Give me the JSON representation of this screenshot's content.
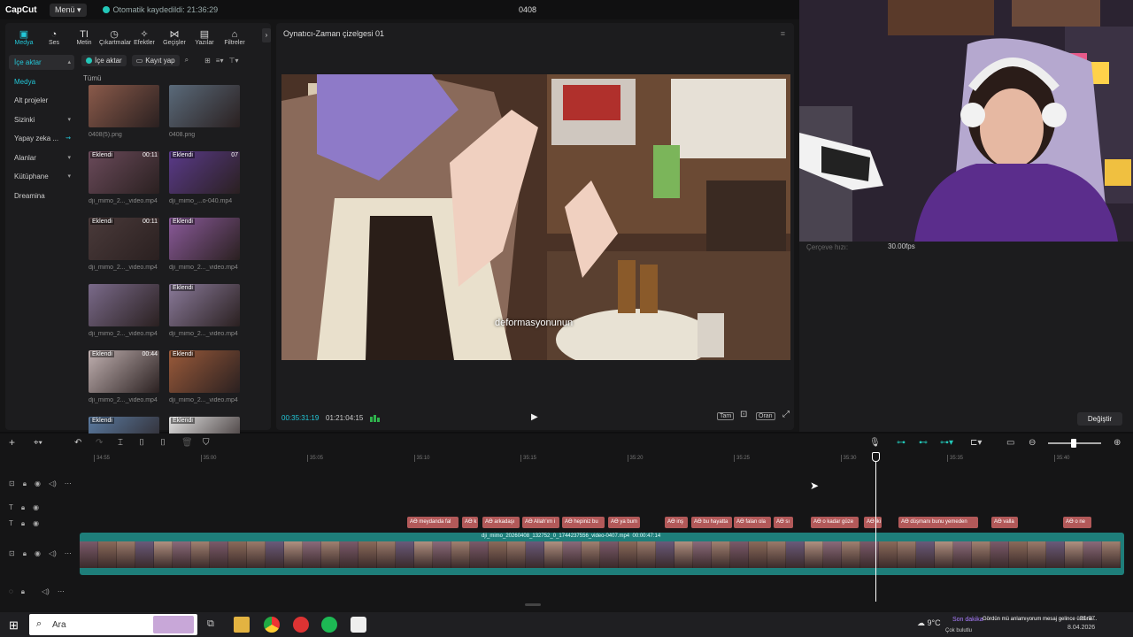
{
  "titlebar": {
    "logo": "CapCut",
    "menu_label": "Menü",
    "save_status": "Otomatik kaydedildi: 21:36:29",
    "project_name": "0408"
  },
  "toolbar": {
    "items": [
      {
        "label": "Medya",
        "icon": "media-icon"
      },
      {
        "label": "Ses",
        "icon": "audio-icon"
      },
      {
        "label": "Metin",
        "icon": "text-icon"
      },
      {
        "label": "Çıkartmalar",
        "icon": "sticker-icon"
      },
      {
        "label": "Efektler",
        "icon": "effects-icon"
      },
      {
        "label": "Geçişler",
        "icon": "transitions-icon"
      },
      {
        "label": "Yazılar",
        "icon": "captions-icon"
      },
      {
        "label": "Filtreler",
        "icon": "filters-icon"
      }
    ]
  },
  "sidenav": {
    "items": [
      "İçe aktar",
      "Medya",
      "Alt projeler",
      "Sizinki",
      "Yapay zeka ...",
      "Alanlar",
      "Kütüphane",
      "Dreamina"
    ]
  },
  "media": {
    "import_label": "İçe aktar",
    "record_label": "Kayıt yap",
    "all_label": "Tümü",
    "items": [
      {
        "name": "0408(5).png",
        "badge": "",
        "duration": ""
      },
      {
        "name": "0408.png",
        "badge": "",
        "duration": ""
      },
      {
        "name": "dji_mimo_2..._video.mp4",
        "badge": "Eklendi",
        "duration": "00:11"
      },
      {
        "name": "dji_mimo_...o-040.mp4",
        "badge": "Eklendi",
        "duration": "07"
      },
      {
        "name": "dji_mimo_2..._video.mp4",
        "badge": "Eklendi",
        "duration": "00:11"
      },
      {
        "name": "dji_mimo_2..._video.mp4",
        "badge": "Eklendi",
        "duration": ""
      },
      {
        "name": "dji_mimo_2..._video.mp4",
        "badge": "",
        "duration": ""
      },
      {
        "name": "dji_mimo_2..._video.mp4",
        "badge": "Eklendi",
        "duration": ""
      },
      {
        "name": "dji_mimo_2..._video.mp4",
        "badge": "Eklendi",
        "duration": "00:44"
      },
      {
        "name": "dji_mimo_2..._video.mp4",
        "badge": "Eklendi",
        "duration": ""
      },
      {
        "name": "",
        "badge": "Eklendi",
        "duration": ""
      },
      {
        "name": "",
        "badge": "Eklendi",
        "duration": ""
      }
    ]
  },
  "player": {
    "title": "Oynatıcı-Zaman çizelgesi 01",
    "caption": "deformasyonunun",
    "current_time": "00:35:31:19",
    "total_time": "01:21:04:15",
    "full_label": "Tam",
    "ratio_label": "Oran"
  },
  "properties": {
    "frame_rate_label": "Çerçeve hızı:",
    "frame_rate_value": "30.00fps",
    "change_label": "Değiştir"
  },
  "timeline": {
    "ticks": [
      "34:55",
      "35:00",
      "35:05",
      "35:10",
      "35:15",
      "35:20",
      "35:25",
      "35:30",
      "35:35",
      "35:40"
    ],
    "subtitle_clips": [
      {
        "text": "AƟ meydanda fal"
      },
      {
        "text": "AƟ k"
      },
      {
        "text": "AƟ arkadaşı"
      },
      {
        "text": "AƟ Allah'ım i"
      },
      {
        "text": "AƟ hepiniz bu"
      },
      {
        "text": "AƟ ya bum"
      },
      {
        "text": "AƟ inş"
      },
      {
        "text": "AƟ bu hayatta"
      },
      {
        "text": "AƟ falan ola"
      },
      {
        "text": "AƟ sı"
      },
      {
        "text": "AƟ o kadar güze"
      },
      {
        "text": "AƟ iki"
      },
      {
        "text": "AƟ düşmanı bunu yemeden"
      },
      {
        "text": "AƟ valla"
      },
      {
        "text": "AƟ o ne"
      }
    ],
    "video_clip_label": "dji_mimo_20260408_132752_0_1744237556_video-0407.mp4",
    "video_clip_duration": "00:00:47:14"
  },
  "taskbar": {
    "search_placeholder": "Ara",
    "weather": "9°C",
    "weather_sub": "Çok bulutlu",
    "news_label": "Son dakika",
    "message": "Gördün mü anlamıyorum mesaj gelince üstüne...",
    "time": "21:37",
    "date": "8.04.2026"
  },
  "colors": {
    "accent": "#23c7d8",
    "subtitle_clip": "#b25959",
    "video_track": "#1e7e7a"
  }
}
